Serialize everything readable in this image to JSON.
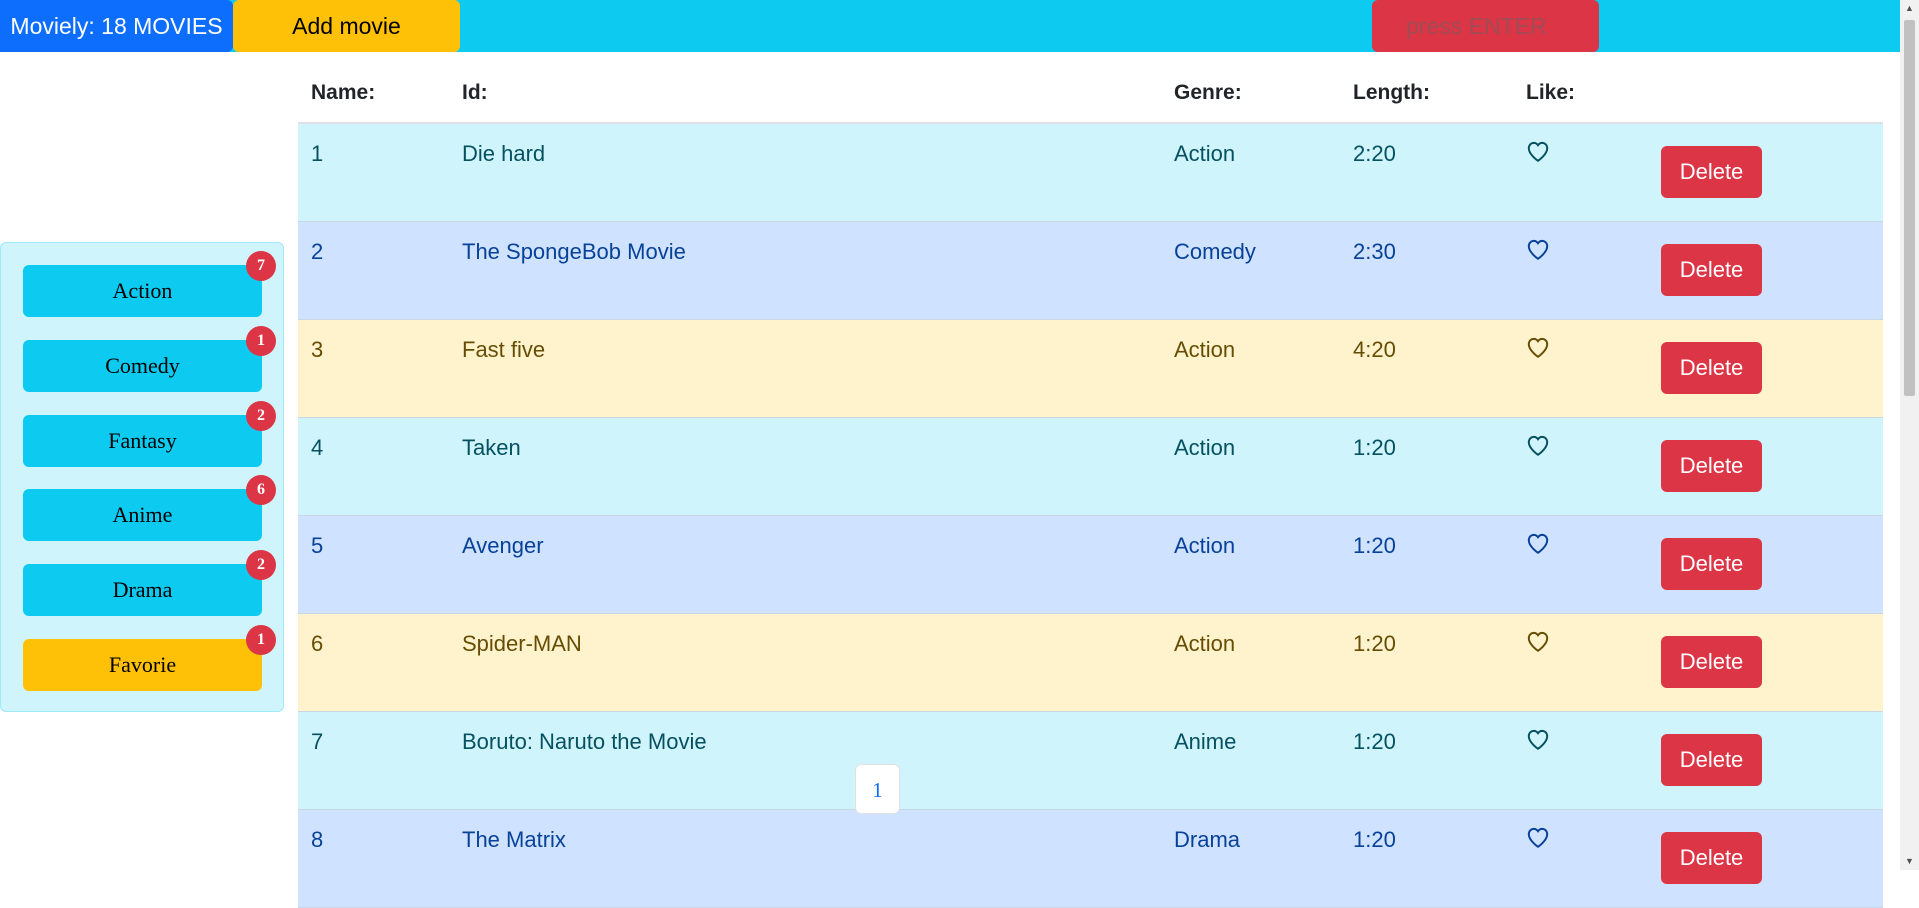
{
  "header": {
    "brand": "Moviely: 18 MOVIES",
    "add_button": "Add movie",
    "search_placeholder": "press ENTER"
  },
  "sidebar": {
    "genres": [
      {
        "label": "Action",
        "count": "7"
      },
      {
        "label": "Comedy",
        "count": "1"
      },
      {
        "label": "Fantasy",
        "count": "2"
      },
      {
        "label": "Anime",
        "count": "6"
      },
      {
        "label": "Drama",
        "count": "2"
      },
      {
        "label": "Favorie",
        "count": "1"
      }
    ]
  },
  "table": {
    "headers": {
      "name": "Name:",
      "id": "Id:",
      "genre": "Genre:",
      "length": "Length:",
      "like": "Like:"
    },
    "rows": [
      {
        "num": "1",
        "title": "Die hard",
        "genre": "Action",
        "length": "2:20",
        "delete": "Delete"
      },
      {
        "num": "2",
        "title": "The SpongeBob Movie",
        "genre": "Comedy",
        "length": "2:30",
        "delete": "Delete"
      },
      {
        "num": "3",
        "title": "Fast five",
        "genre": "Action",
        "length": "4:20",
        "delete": "Delete"
      },
      {
        "num": "4",
        "title": "Taken",
        "genre": "Action",
        "length": "1:20",
        "delete": "Delete"
      },
      {
        "num": "5",
        "title": "Avenger",
        "genre": "Action",
        "length": "1:20",
        "delete": "Delete"
      },
      {
        "num": "6",
        "title": "Spider-MAN",
        "genre": "Action",
        "length": "1:20",
        "delete": "Delete"
      },
      {
        "num": "7",
        "title": "Boruto: Naruto the Movie",
        "genre": "Anime",
        "length": "1:20",
        "delete": "Delete"
      },
      {
        "num": "8",
        "title": "The Matrix",
        "genre": "Drama",
        "length": "1:20",
        "delete": "Delete"
      }
    ]
  },
  "pagination": {
    "current_page": "1"
  },
  "colors": {
    "accent_blue": "#0d6efd",
    "info": "#0dcaf0",
    "warning": "#ffc107",
    "danger": "#dc3545"
  }
}
